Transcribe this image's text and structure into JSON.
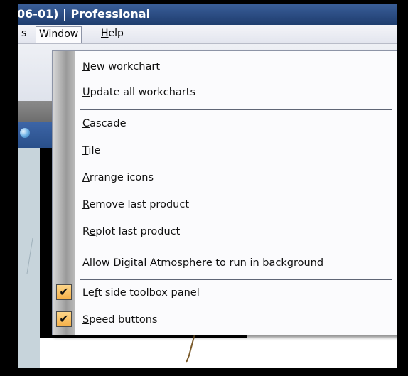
{
  "window": {
    "title_text": "06-01) | Professional"
  },
  "menubar": {
    "partial_item": "s",
    "window_label": "Window",
    "help_label": "Help"
  },
  "window_menu": {
    "items": [
      {
        "label": "New workchart",
        "mnemonic_index": 0
      },
      {
        "label": "Update all workcharts",
        "mnemonic_index": 0
      },
      {
        "label": "Cascade",
        "mnemonic_index": 0
      },
      {
        "label": "Tile",
        "mnemonic_index": 0
      },
      {
        "label": "Arrange icons",
        "mnemonic_index": 0
      },
      {
        "label": "Remove last product",
        "mnemonic_index": 0
      },
      {
        "label": "Replot last product",
        "mnemonic_index": 1
      },
      {
        "label": "Allow Digital Atmosphere to run in background",
        "mnemonic_index": 2
      },
      {
        "label": "Left side toolbox panel",
        "mnemonic_index": 2,
        "checked": true
      },
      {
        "label": "Speed buttons",
        "mnemonic_index": 0,
        "checked": true
      }
    ]
  },
  "colors": {
    "titlebar": "#2b4c82",
    "menu_bg": "#fbfbfd",
    "check_fill": "#f6b048",
    "map_line": "#7a5a2a"
  }
}
